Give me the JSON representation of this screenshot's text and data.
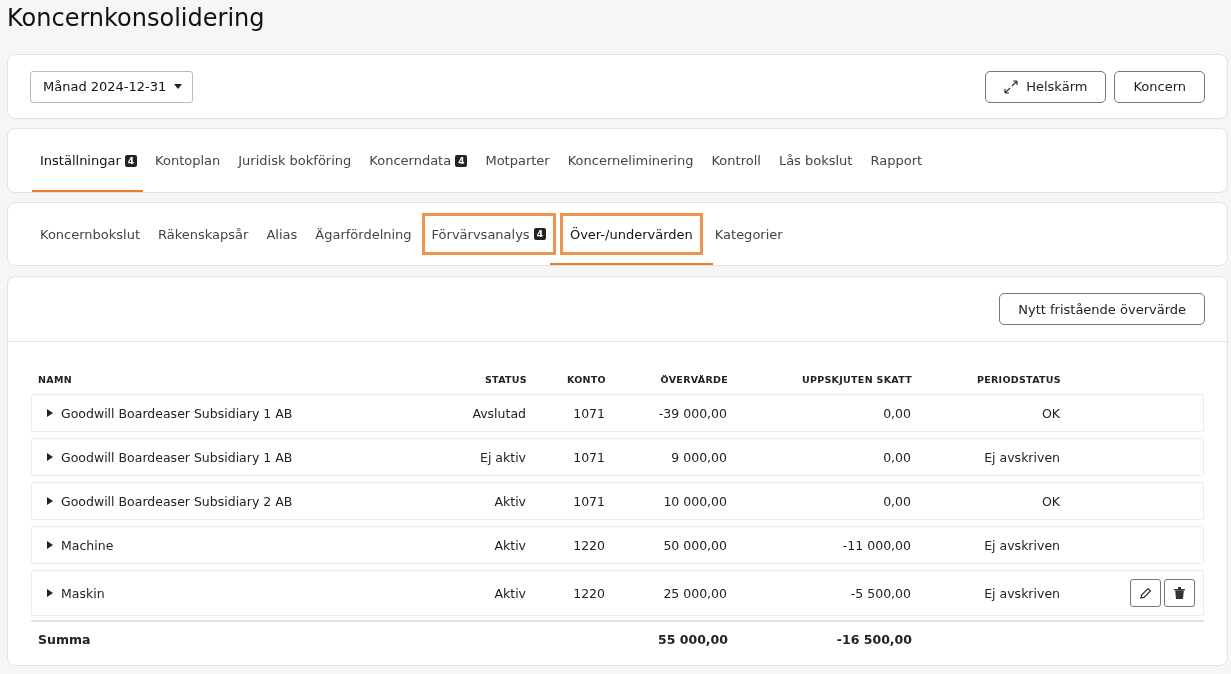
{
  "page_title": "Koncernkonsolidering",
  "period_select": {
    "value": "Månad 2024-12-31"
  },
  "header_buttons": [
    {
      "label": "Helskärm",
      "kind": "fullscreen"
    },
    {
      "label": "Koncern",
      "kind": "plain"
    }
  ],
  "main_tabs": [
    {
      "label": "Inställningar",
      "badge": "4",
      "selected": true
    },
    {
      "label": "Kontoplan",
      "selected": false
    },
    {
      "label": "Juridisk bokföring",
      "selected": false
    },
    {
      "label": "Koncerndata",
      "badge": "4",
      "selected": false
    },
    {
      "label": "Motparter",
      "selected": false
    },
    {
      "label": "Koncerneliminering",
      "selected": false
    },
    {
      "label": "Kontroll",
      "selected": false
    },
    {
      "label": "Lås bokslut",
      "selected": false
    },
    {
      "label": "Rapport",
      "selected": false
    }
  ],
  "sub_tabs": [
    {
      "label": "Koncernbokslut",
      "selected": false,
      "highlighted": false
    },
    {
      "label": "Räkenskapsår",
      "selected": false,
      "highlighted": false
    },
    {
      "label": "Alias",
      "selected": false,
      "highlighted": false
    },
    {
      "label": "Ägarfördelning",
      "selected": false,
      "highlighted": false
    },
    {
      "label": "Förvärvsanalys",
      "badge": "4",
      "selected": false,
      "highlighted": true
    },
    {
      "label": "Över-/undervärden",
      "selected": true,
      "highlighted": true
    },
    {
      "label": "Kategorier",
      "selected": false,
      "highlighted": false
    }
  ],
  "new_button": "Nytt fristående övervärde",
  "table": {
    "columns": [
      "NAMN",
      "STATUS",
      "KONTO",
      "ÖVERVÄRDE",
      "UPPSKJUTEN SKATT",
      "PERIODSTATUS"
    ],
    "rows": [
      {
        "name": "Goodwill Boardeaser Subsidiary 1 AB",
        "status": "Avslutad",
        "konto": "1071",
        "overvarde": "-39 000,00",
        "skatt": "0,00",
        "periodstatus": "OK",
        "expanded": false,
        "actions": false
      },
      {
        "name": "Goodwill Boardeaser Subsidiary 1 AB",
        "status": "Ej aktiv",
        "konto": "1071",
        "overvarde": "9 000,00",
        "skatt": "0,00",
        "periodstatus": "Ej avskriven",
        "expanded": false,
        "actions": false
      },
      {
        "name": "Goodwill Boardeaser Subsidiary 2 AB",
        "status": "Aktiv",
        "konto": "1071",
        "overvarde": "10 000,00",
        "skatt": "0,00",
        "periodstatus": "OK",
        "expanded": false,
        "actions": false
      },
      {
        "name": "Machine",
        "status": "Aktiv",
        "konto": "1220",
        "overvarde": "50 000,00",
        "skatt": "-11 000,00",
        "periodstatus": "Ej avskriven",
        "expanded": false,
        "actions": false
      },
      {
        "name": "Maskin",
        "status": "Aktiv",
        "konto": "1220",
        "overvarde": "25 000,00",
        "skatt": "-5 500,00",
        "periodstatus": "Ej avskriven",
        "expanded": false,
        "actions": true
      }
    ],
    "total": {
      "label": "Summa",
      "overvarde": "55 000,00",
      "skatt": "-16 500,00"
    }
  }
}
